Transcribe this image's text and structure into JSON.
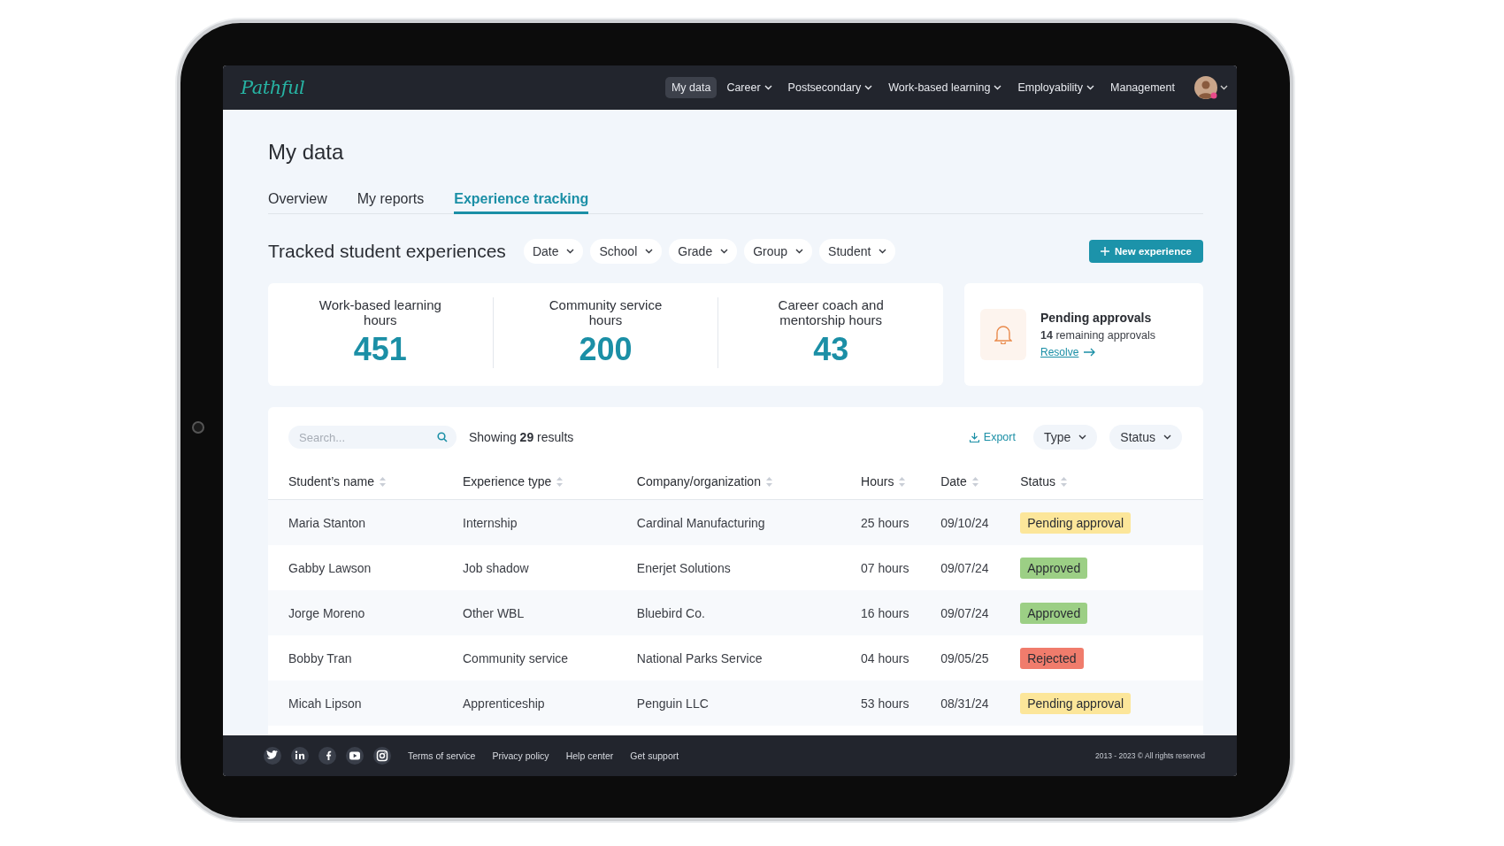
{
  "brand": {
    "logo": "Pathful"
  },
  "nav": [
    {
      "label": "My data",
      "selected": true,
      "dropdown": false
    },
    {
      "label": "Career",
      "selected": false,
      "dropdown": true
    },
    {
      "label": "Postsecondary",
      "selected": false,
      "dropdown": true
    },
    {
      "label": "Work-based learning",
      "selected": false,
      "dropdown": true
    },
    {
      "label": "Employability",
      "selected": false,
      "dropdown": true
    },
    {
      "label": "Management",
      "selected": false,
      "dropdown": false
    }
  ],
  "page_title": "My data",
  "tabs": [
    {
      "label": "Overview",
      "selected": false
    },
    {
      "label": "My reports",
      "selected": false
    },
    {
      "label": "Experience tracking",
      "selected": true
    }
  ],
  "section_title": "Tracked student experiences",
  "filters": [
    "Date",
    "School",
    "Grade",
    "Group",
    "Student"
  ],
  "new_button": "New experience",
  "stats": [
    {
      "label": "Work-based learning hours",
      "value": "451"
    },
    {
      "label": "Community service hours",
      "value": "200"
    },
    {
      "label": "Career coach and mentorship hours",
      "value": "43"
    }
  ],
  "pending": {
    "title": "Pending approvals",
    "count": "14",
    "text": "remaining approvals",
    "link": "Resolve"
  },
  "table": {
    "search": {
      "placeholder": "Search..."
    },
    "showing": {
      "prefix": "Showing",
      "count": "29",
      "suffix": "results"
    },
    "export": "Export",
    "table_filters": [
      "Type",
      "Status"
    ],
    "columns": [
      "Student’s name",
      "Experience type",
      "Company/organization",
      "Hours",
      "Date",
      "Status"
    ],
    "rows": [
      {
        "cells": [
          "Maria Stanton",
          "Internship",
          "Cardinal Manufacturing",
          "25 hours",
          "09/10/24"
        ],
        "status": "Pending approval",
        "kind": "pending"
      },
      {
        "cells": [
          "Gabby Lawson",
          "Job shadow",
          "Enerjet Solutions",
          "07 hours",
          "09/07/24"
        ],
        "status": "Approved",
        "kind": "approved"
      },
      {
        "cells": [
          "Jorge Moreno",
          "Other WBL",
          "Bluebird Co.",
          "16 hours",
          "09/07/24"
        ],
        "status": "Approved",
        "kind": "approved"
      },
      {
        "cells": [
          "Bobby Tran",
          "Community service",
          "National Parks Service",
          "04 hours",
          "09/05/25"
        ],
        "status": "Rejected",
        "kind": "rejected"
      },
      {
        "cells": [
          "Micah Lipson",
          "Apprenticeship",
          "Penguin LLC",
          "53 hours",
          "08/31/24"
        ],
        "status": "Pending approval",
        "kind": "pending"
      }
    ]
  },
  "footer": {
    "social": [
      {
        "kind": "twitter"
      },
      {
        "kind": "linkedin"
      },
      {
        "kind": "facebook"
      },
      {
        "kind": "youtube"
      },
      {
        "kind": "instagram"
      }
    ],
    "links": [
      "Terms of service",
      "Privacy policy",
      "Help center",
      "Get support"
    ],
    "copyright": "2013 - 2023 © All rights reserved"
  }
}
